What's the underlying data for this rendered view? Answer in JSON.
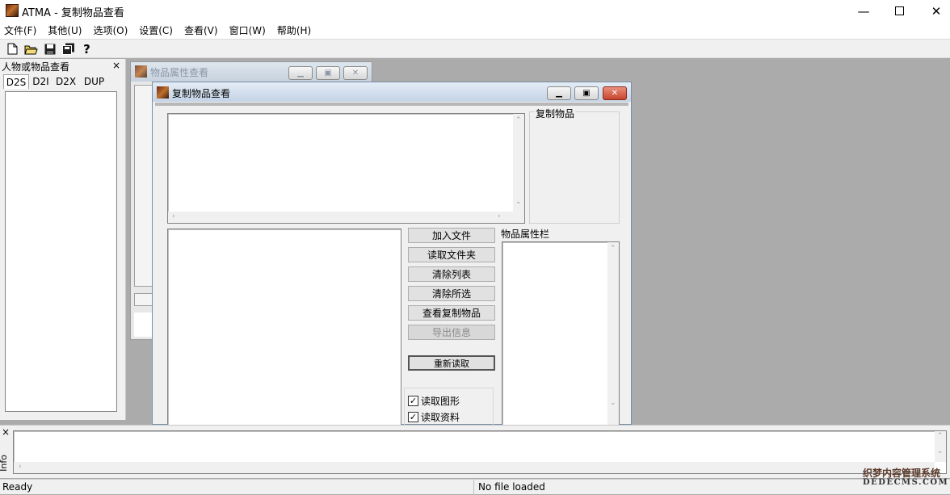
{
  "window": {
    "title": "ATMA - 复制物品查看"
  },
  "menu": [
    "文件(F)",
    "其他(U)",
    "选项(O)",
    "设置(C)",
    "查看(V)",
    "窗口(W)",
    "帮助(H)"
  ],
  "left_panel": {
    "title": "人物或物品查看",
    "close": "×",
    "tabs": [
      "D2S",
      "D2I",
      "D2X",
      "DUP"
    ]
  },
  "props_window": {
    "title": "物品属性查看"
  },
  "dup_window": {
    "title": "复制物品查看",
    "dup_items_label": "复制物品",
    "attr_label": "物品属性栏",
    "buttons": {
      "add_file": "加入文件",
      "read_folder": "读取文件夹",
      "clear_list": "清除列表",
      "clear_selected": "清除所选",
      "view_dups": "查看复制物品",
      "export_info": "导出信息",
      "reload": "重新读取"
    },
    "checkboxes": [
      "读取图形",
      "读取资料"
    ]
  },
  "info_panel": {
    "label": "Info",
    "close": "×"
  },
  "status": {
    "left": "Ready",
    "right": "No file loaded"
  },
  "watermark": {
    "line1": "织梦内容管理系统",
    "line2": "DEDECMS.COM"
  }
}
